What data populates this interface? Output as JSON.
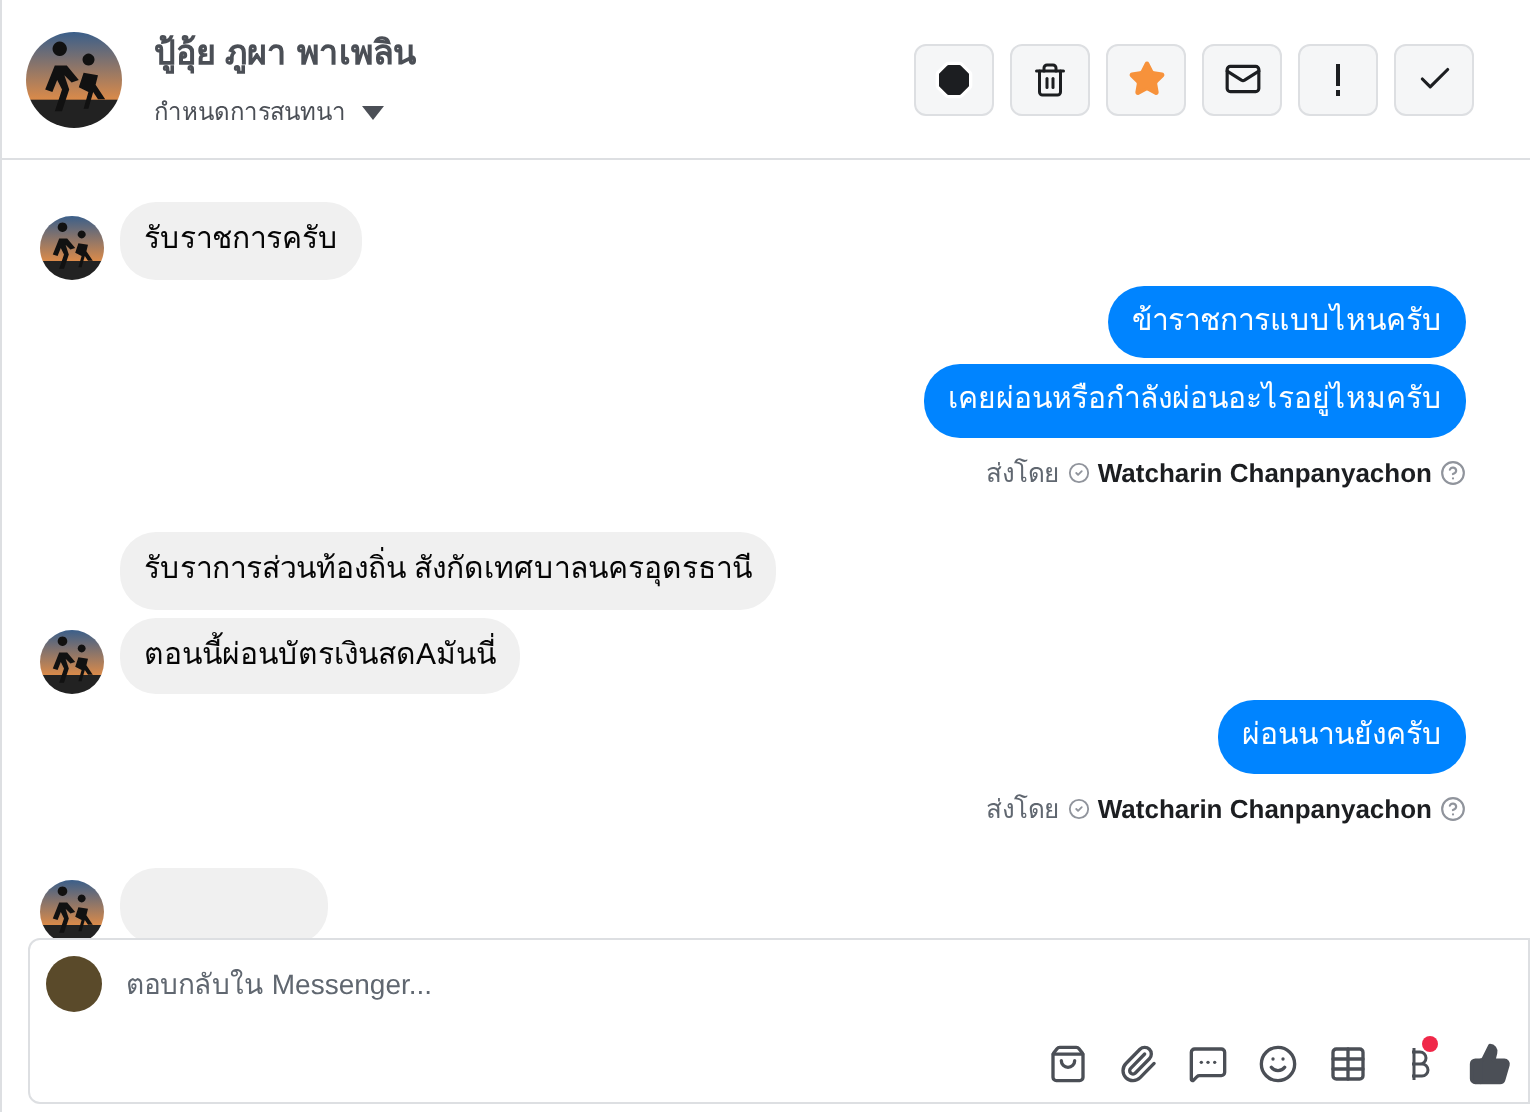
{
  "header": {
    "name": "ปู้อุ้ย ภูผา พาเพลิน",
    "subtitle": "กำหนดการสนทนา"
  },
  "messages": [
    {
      "kind": "received",
      "text": "รับราชการครับ",
      "show_avatar": true
    },
    {
      "kind": "sent",
      "text": "ข้าราชการแบบไหนครับ"
    },
    {
      "kind": "sent",
      "text": "เคยผ่อนหรือกำลังผ่อนอะไรอยู่ไหมครับ"
    },
    {
      "kind": "sent_by",
      "prefix": "ส่งโดย",
      "sender": "Watcharin Chanpanyachon"
    },
    {
      "kind": "received",
      "text": "รับราการส่วนท้องถิ่น สังกัดเทศบาลนครอุดรธานี",
      "show_avatar": false
    },
    {
      "kind": "received",
      "text": "ตอนนี้ผ่อนบัตรเงินสดAมันนี่",
      "show_avatar": true
    },
    {
      "kind": "sent",
      "text": "ผ่อนนานยังครับ"
    },
    {
      "kind": "sent_by",
      "prefix": "ส่งโดย",
      "sender": "Watcharin Chanpanyachon"
    },
    {
      "kind": "received",
      "show_avatar": true
    }
  ],
  "composer": {
    "placeholder": "ตอบกลับใน Messenger...",
    "payment_badge": true
  }
}
